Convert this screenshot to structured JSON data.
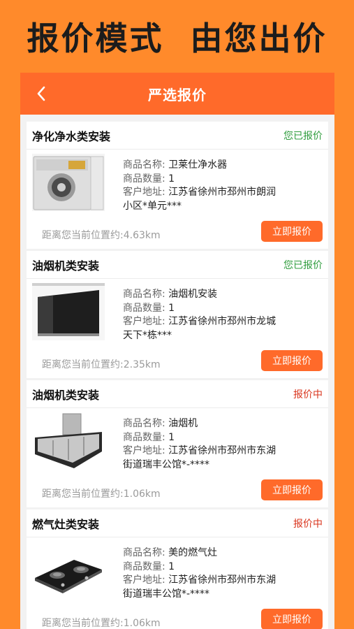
{
  "banner": {
    "text": "报价模式  由您出价"
  },
  "nav": {
    "title": "严选报价"
  },
  "labels": {
    "name": "商品名称:",
    "qty": "商品数量:",
    "addr": "客户地址:"
  },
  "button_label": "立即报价",
  "cards": [
    {
      "title": "净化净水类安装",
      "status": "您已报价",
      "status_type": "done",
      "product_name": "卫莱仕净水器",
      "quantity": "1",
      "address_line1": "江苏省徐州市邳州市朗润",
      "address_line2": "小区*单元***",
      "distance": "距离您当前位置约:4.63km",
      "image": "water-purifier"
    },
    {
      "title": "油烟机类安装",
      "status": "您已报价",
      "status_type": "done",
      "product_name": "油烟机安装",
      "quantity": "1",
      "address_line1": "江苏省徐州市邳州市龙城",
      "address_line2": "天下*栋***",
      "distance": "距离您当前位置约:2.35km",
      "image": "range-hood-black"
    },
    {
      "title": "油烟机类安装",
      "status": "报价中",
      "status_type": "pending",
      "product_name": "油烟机",
      "quantity": "1",
      "address_line1": "江苏省徐州市邳州市东湖",
      "address_line2": "街道瑞丰公馆*-****",
      "distance": "距离您当前位置约:1.06km",
      "image": "range-hood-silver"
    },
    {
      "title": "燃气灶类安装",
      "status": "报价中",
      "status_type": "pending",
      "product_name": "美的燃气灶",
      "quantity": "1",
      "address_line1": "江苏省徐州市邳州市东湖",
      "address_line2": "街道瑞丰公馆*-****",
      "distance": "距离您当前位置约:1.06km",
      "image": "gas-stove"
    }
  ],
  "colors": {
    "brand": "#ff6a2a",
    "background": "#ff8a2b",
    "done": "#2e9c3c",
    "pending": "#d9341c"
  }
}
